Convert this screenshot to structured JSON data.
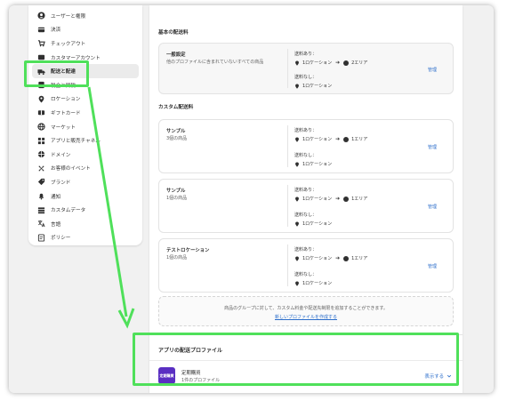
{
  "sidebar": {
    "items": [
      {
        "label": "ユーザーと権限",
        "icon": "user-icon"
      },
      {
        "label": "決済",
        "icon": "payment-icon"
      },
      {
        "label": "チェックアウト",
        "icon": "cart-icon"
      },
      {
        "label": "カスタマーアカウント",
        "icon": "account-icon"
      },
      {
        "label": "配送と配達",
        "icon": "truck-icon",
        "active": true
      },
      {
        "label": "税金と関税",
        "icon": "tax-icon"
      },
      {
        "label": "ロケーション",
        "icon": "location-icon"
      },
      {
        "label": "ギフトカード",
        "icon": "gift-card-icon"
      },
      {
        "label": "マーケット",
        "icon": "globe-icon"
      },
      {
        "label": "アプリと販売チャネル",
        "icon": "apps-icon"
      },
      {
        "label": "ドメイン",
        "icon": "domain-icon"
      },
      {
        "label": "お客様のイベント",
        "icon": "events-icon"
      },
      {
        "label": "ブランド",
        "icon": "brand-icon"
      },
      {
        "label": "通知",
        "icon": "bell-icon"
      },
      {
        "label": "カスタムデータ",
        "icon": "data-icon"
      },
      {
        "label": "言語",
        "icon": "language-icon"
      },
      {
        "label": "ポリシー",
        "icon": "policy-icon"
      }
    ]
  },
  "main": {
    "intro_text": "",
    "general_section": {
      "title": "基本の配送料",
      "profile": {
        "name": "一般設定",
        "count": "他のプロファイルに含まれていないすべての商品",
        "with_rates_label": "送料あり：",
        "with_rates_from": "1ロケーション",
        "with_rates_to": "2エリア",
        "without_rates_label": "送料なし：",
        "without_rates_value": "1ロケーション",
        "manage": "管理"
      }
    },
    "custom_section": {
      "title": "カスタム配送料",
      "profiles": [
        {
          "name": "サンプル",
          "count": "3個の商品",
          "with_rates_label": "送料あり：",
          "with_rates_from": "1ロケーション",
          "with_rates_to": "1エリア",
          "without_rates_label": "送料なし：",
          "without_rates_value": "1ロケーション",
          "manage": "管理"
        },
        {
          "name": "サンプル",
          "count": "1個の商品",
          "with_rates_label": "送料あり：",
          "with_rates_from": "1ロケーション",
          "with_rates_to": "1エリア",
          "without_rates_label": "送料なし：",
          "without_rates_value": "1ロケーション",
          "manage": "管理"
        },
        {
          "name": "テストロケーション",
          "count": "1個の商品",
          "with_rates_label": "送料あり：",
          "with_rates_from": "1ロケーション",
          "with_rates_to": "1エリア",
          "without_rates_label": "送料なし：",
          "without_rates_value": "1ロケーション",
          "manage": "管理"
        }
      ]
    },
    "info": {
      "text": "商品のグループに対して、カスタム料金や配送先制限を追加することができます。",
      "link": "新しいプロファイルを作成する"
    },
    "app_section": {
      "title": "アプリの配送プロファイル",
      "app_logo_text": "定期購買",
      "app_name": "定期購買",
      "app_sub": "1件のプロファイル",
      "show_label": "表示する"
    }
  },
  "colors": {
    "highlight": "#4fe05a",
    "link": "#2c6ecb",
    "app_logo": "#5a2fc2"
  }
}
